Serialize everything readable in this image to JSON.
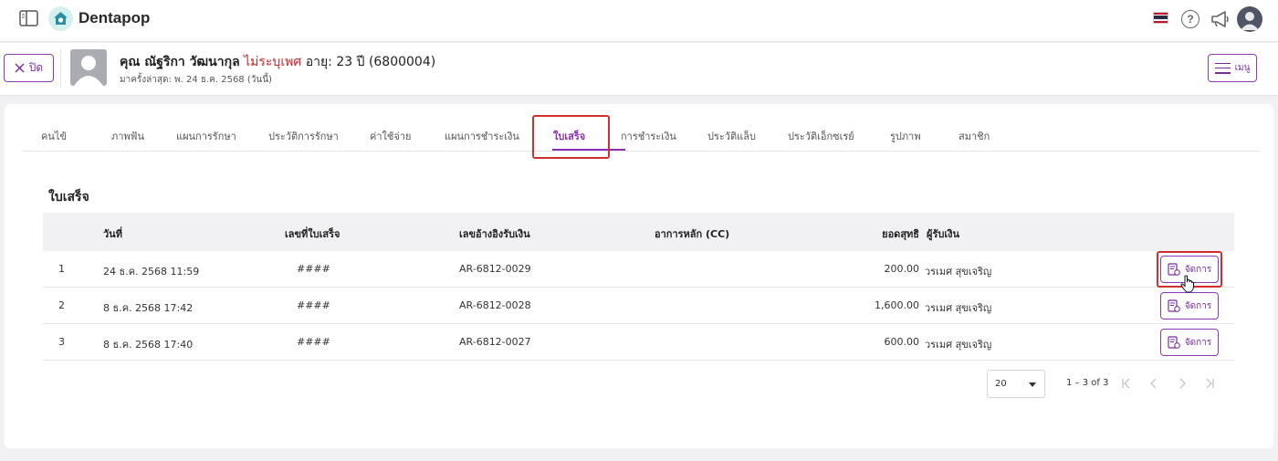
{
  "app": {
    "name": "Dentapop"
  },
  "patient": {
    "close_label": "ปิด",
    "name": "คุณ ณัฐริกา วัฒนากุล",
    "gender": "ไม่ระบุเพศ",
    "age": "อายุ: 23 ปี",
    "hn": "(6800004)",
    "last_visit": "มาครั้งล่าสุด: พ. 24 ธ.ค. 2568 (วันนี้)",
    "menu_label": "เมนู"
  },
  "tabs": [
    {
      "label": "คนไข้"
    },
    {
      "label": "ภาพฟัน"
    },
    {
      "label": "แผนการรักษา"
    },
    {
      "label": "ประวัติการรักษา"
    },
    {
      "label": "ค่าใช้จ่าย"
    },
    {
      "label": "แผนการชำระเงิน"
    },
    {
      "label": "ใบเสร็จ",
      "active": true
    },
    {
      "label": "การชำระเงิน"
    },
    {
      "label": "ประวัติแล็บ"
    },
    {
      "label": "ประวัติเอ็กซเรย์"
    },
    {
      "label": "รูปภาพ"
    },
    {
      "label": "สมาชิก"
    }
  ],
  "receipts": {
    "title": "ใบเสร็จ",
    "columns": {
      "date": "วันที่",
      "receipt_no": "เลขที่ใบเสร็จ",
      "payment_ref": "เลขอ้างอิงรับเงิน",
      "cc": "อาการหลัก (CC)",
      "net": "ยอดสุทธิ",
      "receiver": "ผู้รับเงิน"
    },
    "rows": [
      {
        "index": "1",
        "date": "24 ธ.ค. 2568 11:59",
        "receipt_no": "####",
        "payment_ref": "AR-6812-0029",
        "cc": "",
        "net": "200.00",
        "receiver": "วรเมศ สุขเจริญ",
        "action": "จัดการ"
      },
      {
        "index": "2",
        "date": "8 ธ.ค. 2568 17:42",
        "receipt_no": "####",
        "payment_ref": "AR-6812-0028",
        "cc": "",
        "net": "1,600.00",
        "receiver": "วรเมศ สุขเจริญ",
        "action": "จัดการ"
      },
      {
        "index": "3",
        "date": "8 ธ.ค. 2568 17:40",
        "receipt_no": "####",
        "payment_ref": "AR-6812-0027",
        "cc": "",
        "net": "600.00",
        "receiver": "วรเมศ สุขเจริญ",
        "action": "จัดการ"
      }
    ],
    "pagination": {
      "page_size": "20",
      "range": "1 – 3 of 3"
    }
  },
  "colors": {
    "accent": "#8b2fb8",
    "highlight": "#d32f2f",
    "gender": "#c0272d"
  },
  "icons": [
    "sidebar-toggle-icon",
    "home-logo-icon",
    "thai-flag-icon",
    "help-icon",
    "megaphone-icon",
    "user-avatar-icon",
    "close-icon",
    "hamburger-icon",
    "receipt-manage-icon",
    "first-page-icon",
    "prev-page-icon",
    "next-page-icon",
    "last-page-icon"
  ]
}
